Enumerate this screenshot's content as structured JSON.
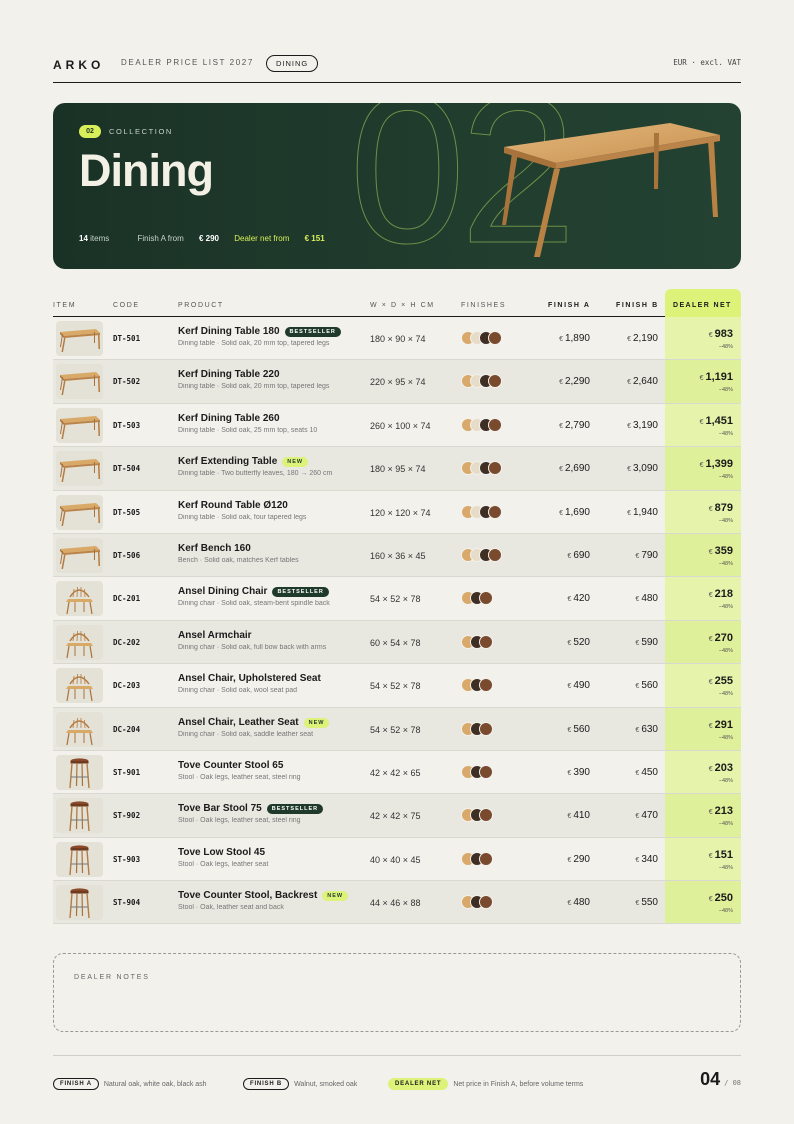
{
  "header": {
    "brand": "ARKO",
    "doc_title": "DEALER PRICE LIST 2027",
    "section_pill": "DINING",
    "currency_note": "EUR · excl. VAT"
  },
  "hero": {
    "badge": "02",
    "eyebrow": "COLLECTION",
    "title": "Dining",
    "big_number": "02",
    "items_count": "14",
    "items_label": "items",
    "finish_a_label": "Finish A from",
    "finish_a_from": "€ 290",
    "dealer_net_label": "Dealer net from",
    "dealer_net_from": "€ 151"
  },
  "columns": {
    "item": "ITEM",
    "code": "CODE",
    "product": "PRODUCT",
    "dims": "W × D × H CM",
    "finishes": "FINISHES",
    "finish_a": "FINISH A",
    "finish_b": "FINISH B",
    "dealer_net": "DEALER NET"
  },
  "rows": [
    {
      "thumb": "table",
      "code": "DT-501",
      "name": "Kerf Dining Table 180",
      "tag": "BESTSELLER",
      "desc": "Dining table · Solid oak, 20 mm top, tapered legs",
      "dims": "180 × 90 × 74",
      "swatches": [
        "#d8a96a",
        "#e7dcc8",
        "#3f2e24",
        "#7a4a2e"
      ],
      "cur_a": "€",
      "price_a": "1,890",
      "cur_b": "€",
      "price_b": "2,190",
      "cur_net": "€",
      "net": "983",
      "disc": "−48%"
    },
    {
      "thumb": "table",
      "code": "DT-502",
      "name": "Kerf Dining Table 220",
      "tag": "",
      "desc": "Dining table · Solid oak, 20 mm top, tapered legs",
      "dims": "220 × 95 × 74",
      "swatches": [
        "#d8a96a",
        "#e7dcc8",
        "#3f2e24",
        "#7a4a2e"
      ],
      "cur_a": "€",
      "price_a": "2,290",
      "cur_b": "€",
      "price_b": "2,640",
      "cur_net": "€",
      "net": "1,191",
      "disc": "−48%"
    },
    {
      "thumb": "table",
      "code": "DT-503",
      "name": "Kerf Dining Table 260",
      "tag": "",
      "desc": "Dining table · Solid oak, 25 mm top, seats 10",
      "dims": "260 × 100 × 74",
      "swatches": [
        "#d8a96a",
        "#e7dcc8",
        "#3f2e24",
        "#7a4a2e"
      ],
      "cur_a": "€",
      "price_a": "2,790",
      "cur_b": "€",
      "price_b": "3,190",
      "cur_net": "€",
      "net": "1,451",
      "disc": "−48%"
    },
    {
      "thumb": "table",
      "code": "DT-504",
      "name": "Kerf Extending Table",
      "tag": "NEW",
      "desc": "Dining table · Two butterfly leaves, 180 → 260 cm",
      "dims": "180 × 95 × 74",
      "swatches": [
        "#d8a96a",
        "#e7dcc8",
        "#3f2e24",
        "#7a4a2e"
      ],
      "cur_a": "€",
      "price_a": "2,690",
      "cur_b": "€",
      "price_b": "3,090",
      "cur_net": "€",
      "net": "1,399",
      "disc": "−48%"
    },
    {
      "thumb": "table",
      "code": "DT-505",
      "name": "Kerf Round Table Ø120",
      "tag": "",
      "desc": "Dining table · Solid oak, four tapered legs",
      "dims": "120 × 120 × 74",
      "swatches": [
        "#d8a96a",
        "#e7dcc8",
        "#3f2e24",
        "#7a4a2e"
      ],
      "cur_a": "€",
      "price_a": "1,690",
      "cur_b": "€",
      "price_b": "1,940",
      "cur_net": "€",
      "net": "879",
      "disc": "−48%"
    },
    {
      "thumb": "table",
      "code": "DT-506",
      "name": "Kerf Bench 160",
      "tag": "",
      "desc": "Bench · Solid oak, matches Kerf tables",
      "dims": "160 × 36 × 45",
      "swatches": [
        "#d8a96a",
        "#e7dcc8",
        "#3f2e24",
        "#7a4a2e"
      ],
      "cur_a": "€",
      "price_a": "690",
      "cur_b": "€",
      "price_b": "790",
      "cur_net": "€",
      "net": "359",
      "disc": "−48%"
    },
    {
      "thumb": "chair",
      "code": "DC-201",
      "name": "Ansel Dining Chair",
      "tag": "BESTSELLER",
      "desc": "Dining chair · Solid oak, steam-bent spindle back",
      "dims": "54 × 52 × 78",
      "swatches": [
        "#d8a96a",
        "#3f2e24",
        "#7a4a2e"
      ],
      "cur_a": "€",
      "price_a": "420",
      "cur_b": "€",
      "price_b": "480",
      "cur_net": "€",
      "net": "218",
      "disc": "−48%"
    },
    {
      "thumb": "chair",
      "code": "DC-202",
      "name": "Ansel Armchair",
      "tag": "",
      "desc": "Dining chair · Solid oak, full bow back with arms",
      "dims": "60 × 54 × 78",
      "swatches": [
        "#d8a96a",
        "#3f2e24",
        "#7a4a2e"
      ],
      "cur_a": "€",
      "price_a": "520",
      "cur_b": "€",
      "price_b": "590",
      "cur_net": "€",
      "net": "270",
      "disc": "−48%"
    },
    {
      "thumb": "chair",
      "code": "DC-203",
      "name": "Ansel Chair, Upholstered Seat",
      "tag": "",
      "desc": "Dining chair · Solid oak, wool seat pad",
      "dims": "54 × 52 × 78",
      "swatches": [
        "#d8a96a",
        "#3f2e24",
        "#7a4a2e"
      ],
      "cur_a": "€",
      "price_a": "490",
      "cur_b": "€",
      "price_b": "560",
      "cur_net": "€",
      "net": "255",
      "disc": "−48%"
    },
    {
      "thumb": "chair",
      "code": "DC-204",
      "name": "Ansel Chair, Leather Seat",
      "tag": "NEW",
      "desc": "Dining chair · Solid oak, saddle leather seat",
      "dims": "54 × 52 × 78",
      "swatches": [
        "#d8a96a",
        "#3f2e24",
        "#7a4a2e"
      ],
      "cur_a": "€",
      "price_a": "560",
      "cur_b": "€",
      "price_b": "630",
      "cur_net": "€",
      "net": "291",
      "disc": "−48%"
    },
    {
      "thumb": "stool",
      "code": "ST-901",
      "name": "Tove Counter Stool 65",
      "tag": "",
      "desc": "Stool · Oak legs, leather seat, steel ring",
      "dims": "42 × 42 × 65",
      "swatches": [
        "#d8a96a",
        "#3f2e24",
        "#7a4a2e"
      ],
      "cur_a": "€",
      "price_a": "390",
      "cur_b": "€",
      "price_b": "450",
      "cur_net": "€",
      "net": "203",
      "disc": "−48%"
    },
    {
      "thumb": "stool",
      "code": "ST-902",
      "name": "Tove Bar Stool 75",
      "tag": "BESTSELLER",
      "desc": "Stool · Oak legs, leather seat, steel ring",
      "dims": "42 × 42 × 75",
      "swatches": [
        "#d8a96a",
        "#3f2e24",
        "#7a4a2e"
      ],
      "cur_a": "€",
      "price_a": "410",
      "cur_b": "€",
      "price_b": "470",
      "cur_net": "€",
      "net": "213",
      "disc": "−48%"
    },
    {
      "thumb": "stool",
      "code": "ST-903",
      "name": "Tove Low Stool 45",
      "tag": "",
      "desc": "Stool · Oak legs, leather seat",
      "dims": "40 × 40 × 45",
      "swatches": [
        "#d8a96a",
        "#3f2e24",
        "#7a4a2e"
      ],
      "cur_a": "€",
      "price_a": "290",
      "cur_b": "€",
      "price_b": "340",
      "cur_net": "€",
      "net": "151",
      "disc": "−48%"
    },
    {
      "thumb": "stool",
      "code": "ST-904",
      "name": "Tove Counter Stool, Backrest",
      "tag": "NEW",
      "desc": "Stool · Oak, leather seat and back",
      "dims": "44 × 46 × 88",
      "swatches": [
        "#d8a96a",
        "#3f2e24",
        "#7a4a2e"
      ],
      "cur_a": "€",
      "price_a": "480",
      "cur_b": "€",
      "price_b": "550",
      "cur_net": "€",
      "net": "250",
      "disc": "−48%"
    }
  ],
  "notes": {
    "label": "DEALER NOTES"
  },
  "footer": {
    "finish_a": "FINISH A",
    "finish_a_text": "Natural oak, white oak, black ash",
    "finish_b": "FINISH B",
    "finish_b_text": "Walnut, smoked oak",
    "dealer_net": "DEALER NET",
    "dealer_net_text": "Net price in Finish A, before volume terms",
    "page": "04",
    "page_sep": "/",
    "page_total": "08"
  }
}
